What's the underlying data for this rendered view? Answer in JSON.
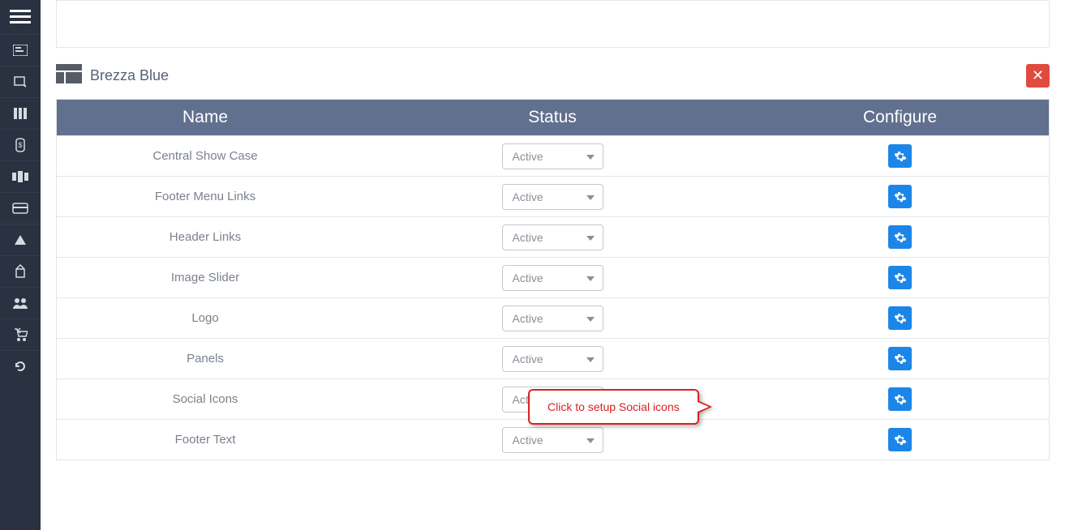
{
  "theme": {
    "title": "Brezza Blue"
  },
  "headers": {
    "name": "Name",
    "status": "Status",
    "configure": "Configure"
  },
  "status_option": "Active",
  "rows": [
    {
      "name": "Central Show Case"
    },
    {
      "name": "Footer Menu Links"
    },
    {
      "name": "Header Links"
    },
    {
      "name": "Image Slider"
    },
    {
      "name": "Logo"
    },
    {
      "name": "Panels"
    },
    {
      "name": "Social Icons"
    },
    {
      "name": "Footer Text"
    }
  ],
  "callout": {
    "text": "Click to setup Social icons"
  },
  "colors": {
    "sidebar_bg": "#2a3140",
    "header_bg": "#62708f",
    "accent_blue": "#1c86e8",
    "danger": "#e04a3f",
    "callout_red": "#d9221e"
  }
}
